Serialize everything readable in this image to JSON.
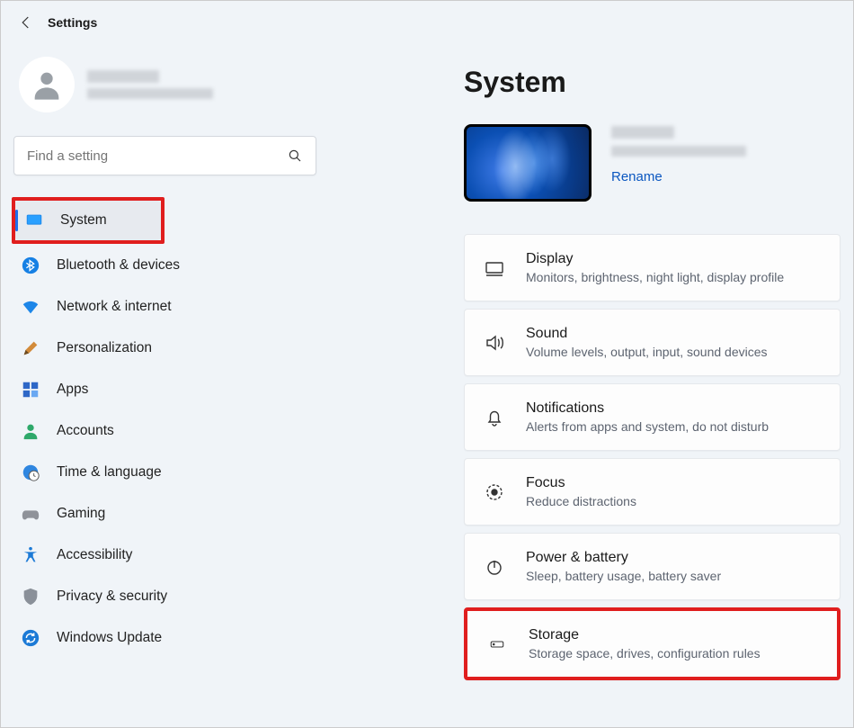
{
  "window": {
    "title": "Settings"
  },
  "search": {
    "placeholder": "Find a setting"
  },
  "sidebar": {
    "items": [
      {
        "id": "system",
        "label": "System",
        "active": true,
        "highlight": true
      },
      {
        "id": "bluetooth",
        "label": "Bluetooth & devices"
      },
      {
        "id": "network",
        "label": "Network & internet"
      },
      {
        "id": "personalization",
        "label": "Personalization"
      },
      {
        "id": "apps",
        "label": "Apps"
      },
      {
        "id": "accounts",
        "label": "Accounts"
      },
      {
        "id": "time",
        "label": "Time & language"
      },
      {
        "id": "gaming",
        "label": "Gaming"
      },
      {
        "id": "accessibility",
        "label": "Accessibility"
      },
      {
        "id": "privacy",
        "label": "Privacy & security"
      },
      {
        "id": "update",
        "label": "Windows Update"
      }
    ]
  },
  "page": {
    "title": "System",
    "rename": "Rename",
    "cards": [
      {
        "id": "display",
        "title": "Display",
        "sub": "Monitors, brightness, night light, display profile"
      },
      {
        "id": "sound",
        "title": "Sound",
        "sub": "Volume levels, output, input, sound devices"
      },
      {
        "id": "notifications",
        "title": "Notifications",
        "sub": "Alerts from apps and system, do not disturb"
      },
      {
        "id": "focus",
        "title": "Focus",
        "sub": "Reduce distractions"
      },
      {
        "id": "power",
        "title": "Power & battery",
        "sub": "Sleep, battery usage, battery saver"
      },
      {
        "id": "storage",
        "title": "Storage",
        "sub": "Storage space, drives, configuration rules",
        "highlight": true
      }
    ]
  }
}
